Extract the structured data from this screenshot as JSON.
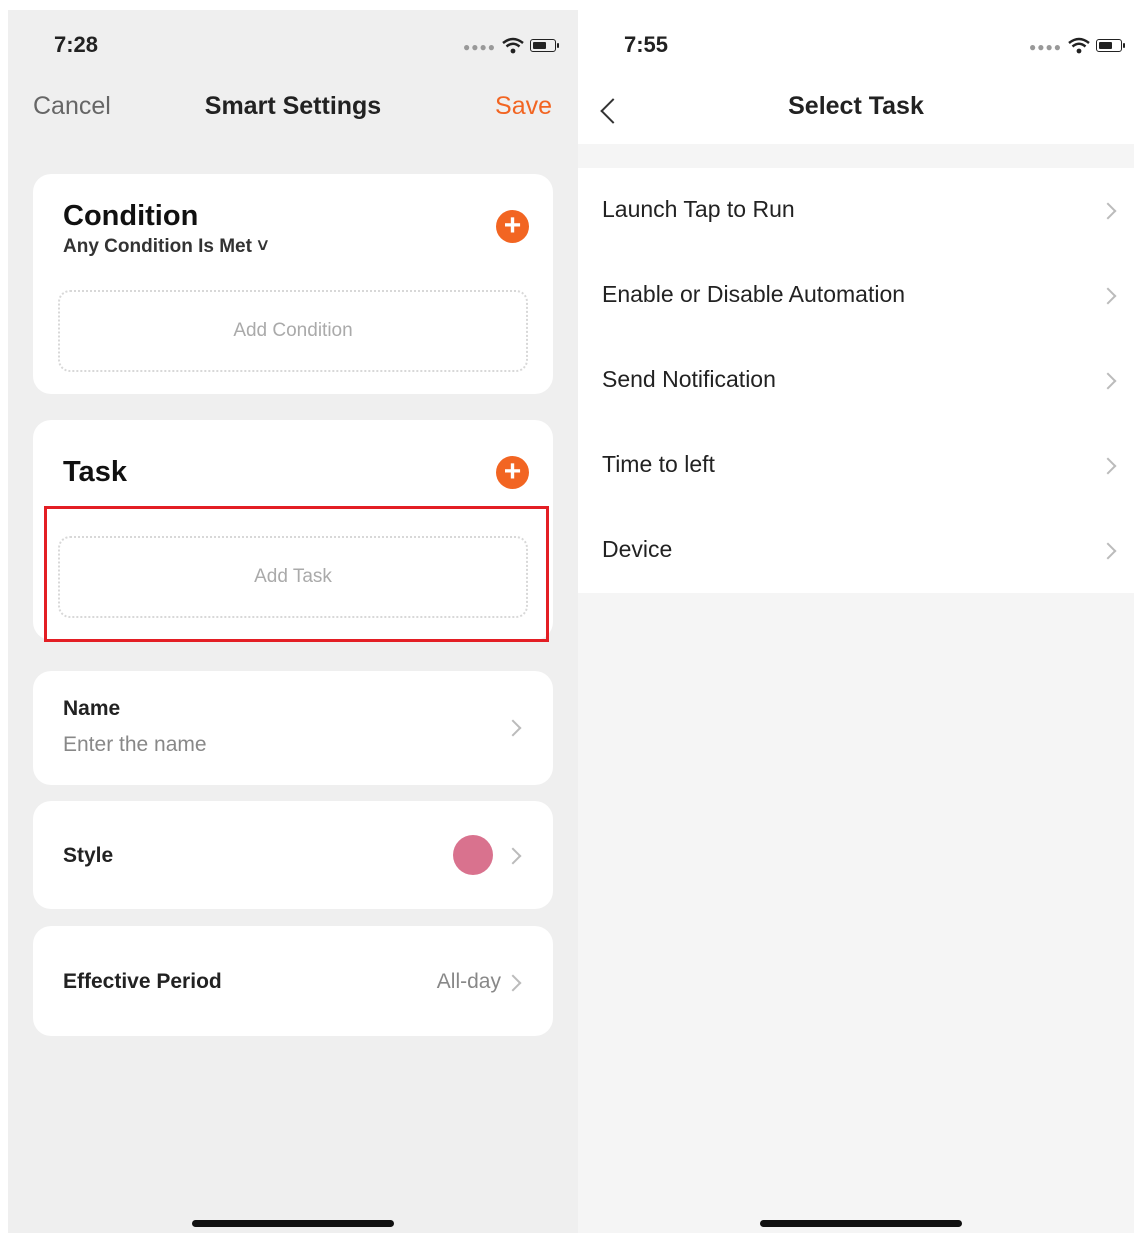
{
  "left_screen": {
    "status_time": "7:28",
    "nav": {
      "cancel": "Cancel",
      "title": "Smart Settings",
      "save": "Save"
    },
    "condition": {
      "title": "Condition",
      "mode": "Any Condition Is Met ˅",
      "placeholder": "Add Condition"
    },
    "task": {
      "title": "Task",
      "placeholder": "Add Task"
    },
    "name_row": {
      "label": "Name",
      "placeholder": "Enter the name"
    },
    "style_row": {
      "label": "Style",
      "color": "#d9728e"
    },
    "period_row": {
      "label": "Effective Period",
      "value": "All-day"
    }
  },
  "right_screen": {
    "status_time": "7:55",
    "nav": {
      "title": "Select Task"
    },
    "items": [
      {
        "label": "Launch Tap to Run"
      },
      {
        "label": "Enable or Disable Automation"
      },
      {
        "label": "Send Notification"
      },
      {
        "label": "Time to left"
      },
      {
        "label": "Device"
      }
    ]
  },
  "colors": {
    "accent": "#f26522",
    "highlight": "#e31e24"
  }
}
